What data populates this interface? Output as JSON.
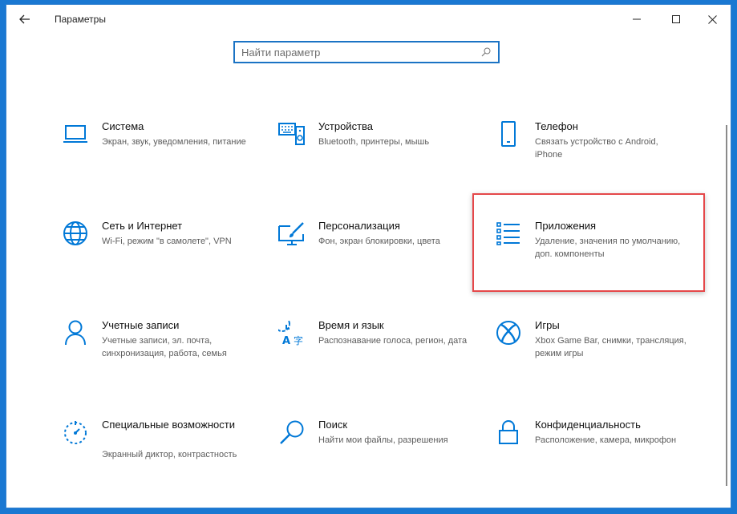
{
  "window": {
    "title": "Параметры"
  },
  "search": {
    "placeholder": "Найти параметр",
    "value": ""
  },
  "accent_color": "#0078d7",
  "highlight_color": "#e5484a",
  "tiles": [
    {
      "title": "Система",
      "desc": "Экран, звук, уведомления, питание",
      "icon": "laptop-icon"
    },
    {
      "title": "Устройства",
      "desc": "Bluetooth, принтеры, мышь",
      "icon": "keyboard-speaker-icon"
    },
    {
      "title": "Телефон",
      "desc": "Связать устройство с Android, iPhone",
      "icon": "phone-icon"
    },
    {
      "title": "Сеть и Интернет",
      "desc": "Wi-Fi, режим \"в самолете\", VPN",
      "icon": "globe-icon"
    },
    {
      "title": "Персонализация",
      "desc": "Фон, экран блокировки, цвета",
      "icon": "paint-brush-icon"
    },
    {
      "title": "Приложения",
      "desc": "Удаление, значения по умолчанию, доп. компоненты",
      "icon": "apps-list-icon"
    },
    {
      "title": "Учетные записи",
      "desc": "Учетные записи, эл. почта, синхронизация, работа, семья",
      "icon": "person-icon"
    },
    {
      "title": "Время и язык",
      "desc": "Распознавание голоса, регион, дата",
      "icon": "time-language-icon"
    },
    {
      "title": "Игры",
      "desc": "Xbox Game Bar, снимки, трансляция, режим игры",
      "icon": "xbox-icon"
    },
    {
      "title": "Специальные возможности",
      "desc": "Экранный диктор, контрастность",
      "icon": "accessibility-timer-icon"
    },
    {
      "title": "Поиск",
      "desc": "Найти мои файлы, разрешения",
      "icon": "magnifier-icon"
    },
    {
      "title": "Конфиденциальность",
      "desc": "Расположение, камера, микрофон",
      "icon": "lock-icon"
    }
  ]
}
